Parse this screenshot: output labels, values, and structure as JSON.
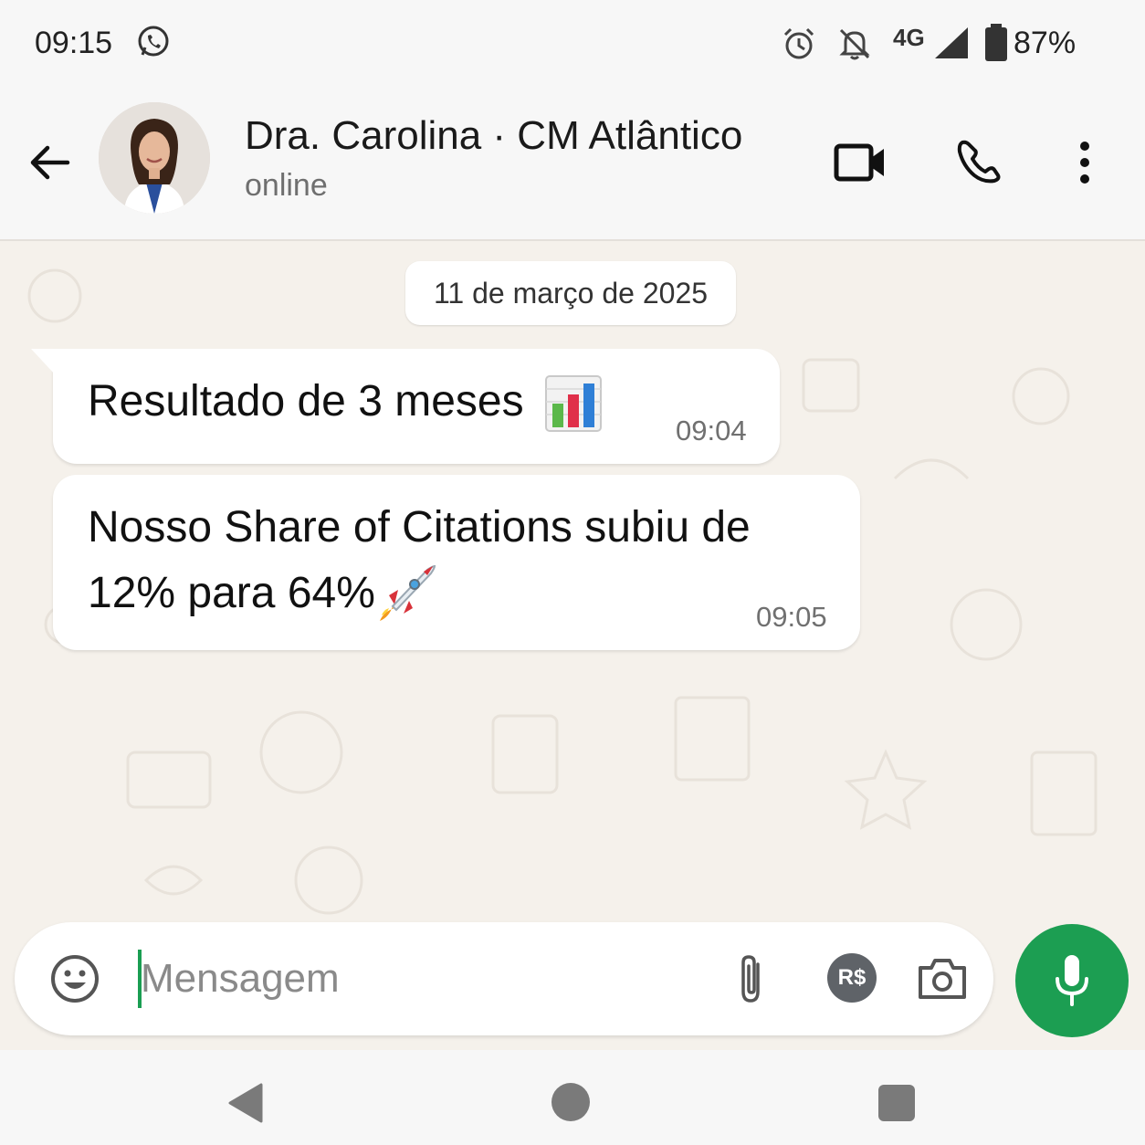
{
  "status_bar": {
    "time": "09:15",
    "network": "4G",
    "battery": "87%",
    "icons": [
      "whatsapp-icon",
      "alarm-icon",
      "bell-off-icon",
      "signal-icon",
      "battery-icon"
    ]
  },
  "header": {
    "contact_name": "Dra. Carolina · CM Atlântico",
    "contact_status": "online",
    "icons": [
      "back-arrow-icon",
      "video-call-icon",
      "phone-icon",
      "more-vert-icon"
    ]
  },
  "chat": {
    "date_label": "11 de março de 2025",
    "messages": [
      {
        "text": "Resultado de 3 meses",
        "emoji": "bar-chart-emoji",
        "time": "09:04"
      },
      {
        "line1": "Nosso Share of Citations subiu de",
        "line2": "12% para 64%",
        "emoji": "rocket-emoji",
        "time": "09:05"
      }
    ]
  },
  "input_bar": {
    "placeholder": "Mensagem",
    "currency_label": "R$",
    "icons": [
      "emoji-icon",
      "attach-icon",
      "currency-icon",
      "camera-icon",
      "mic-icon"
    ]
  },
  "colors": {
    "accent_green": "#1c9e52",
    "chat_background": "#f5f1eb",
    "bubble_incoming": "#ffffff"
  }
}
